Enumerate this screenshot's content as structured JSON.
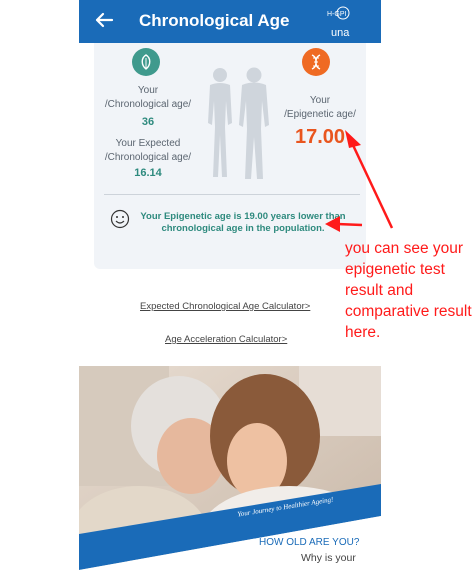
{
  "header": {
    "title": "Chronological Age",
    "brand_logo_text": "H-GPI",
    "brand_name": "una"
  },
  "card": {
    "chron_label": "Your\n/Chronological age/",
    "chron_value": "36",
    "expected_label": "Your Expected\n/Chronological age/",
    "expected_value": "16.14",
    "epi_label": "Your\n/Epigenetic age/",
    "epi_value": "17.00",
    "summary": "Your Epigenetic age is 19.00 years lower than chronological age in the population."
  },
  "links": {
    "expected_calc": "Expected Chronological Age Calculator>",
    "acceleration_calc": "Age Acceleration Calculator>"
  },
  "hero": {
    "banner_text": "Your Journey to Healthier Ageing!",
    "question": "HOW OLD ARE YOU?",
    "subtext": "Why is your"
  },
  "annotation": {
    "text": "you can see your epigenetic test result and comparative result here."
  },
  "colors": {
    "header_blue": "#1a6bb8",
    "teal": "#3f9a8d",
    "orange": "#e9551e",
    "annotation_red": "#ff1a1a"
  }
}
